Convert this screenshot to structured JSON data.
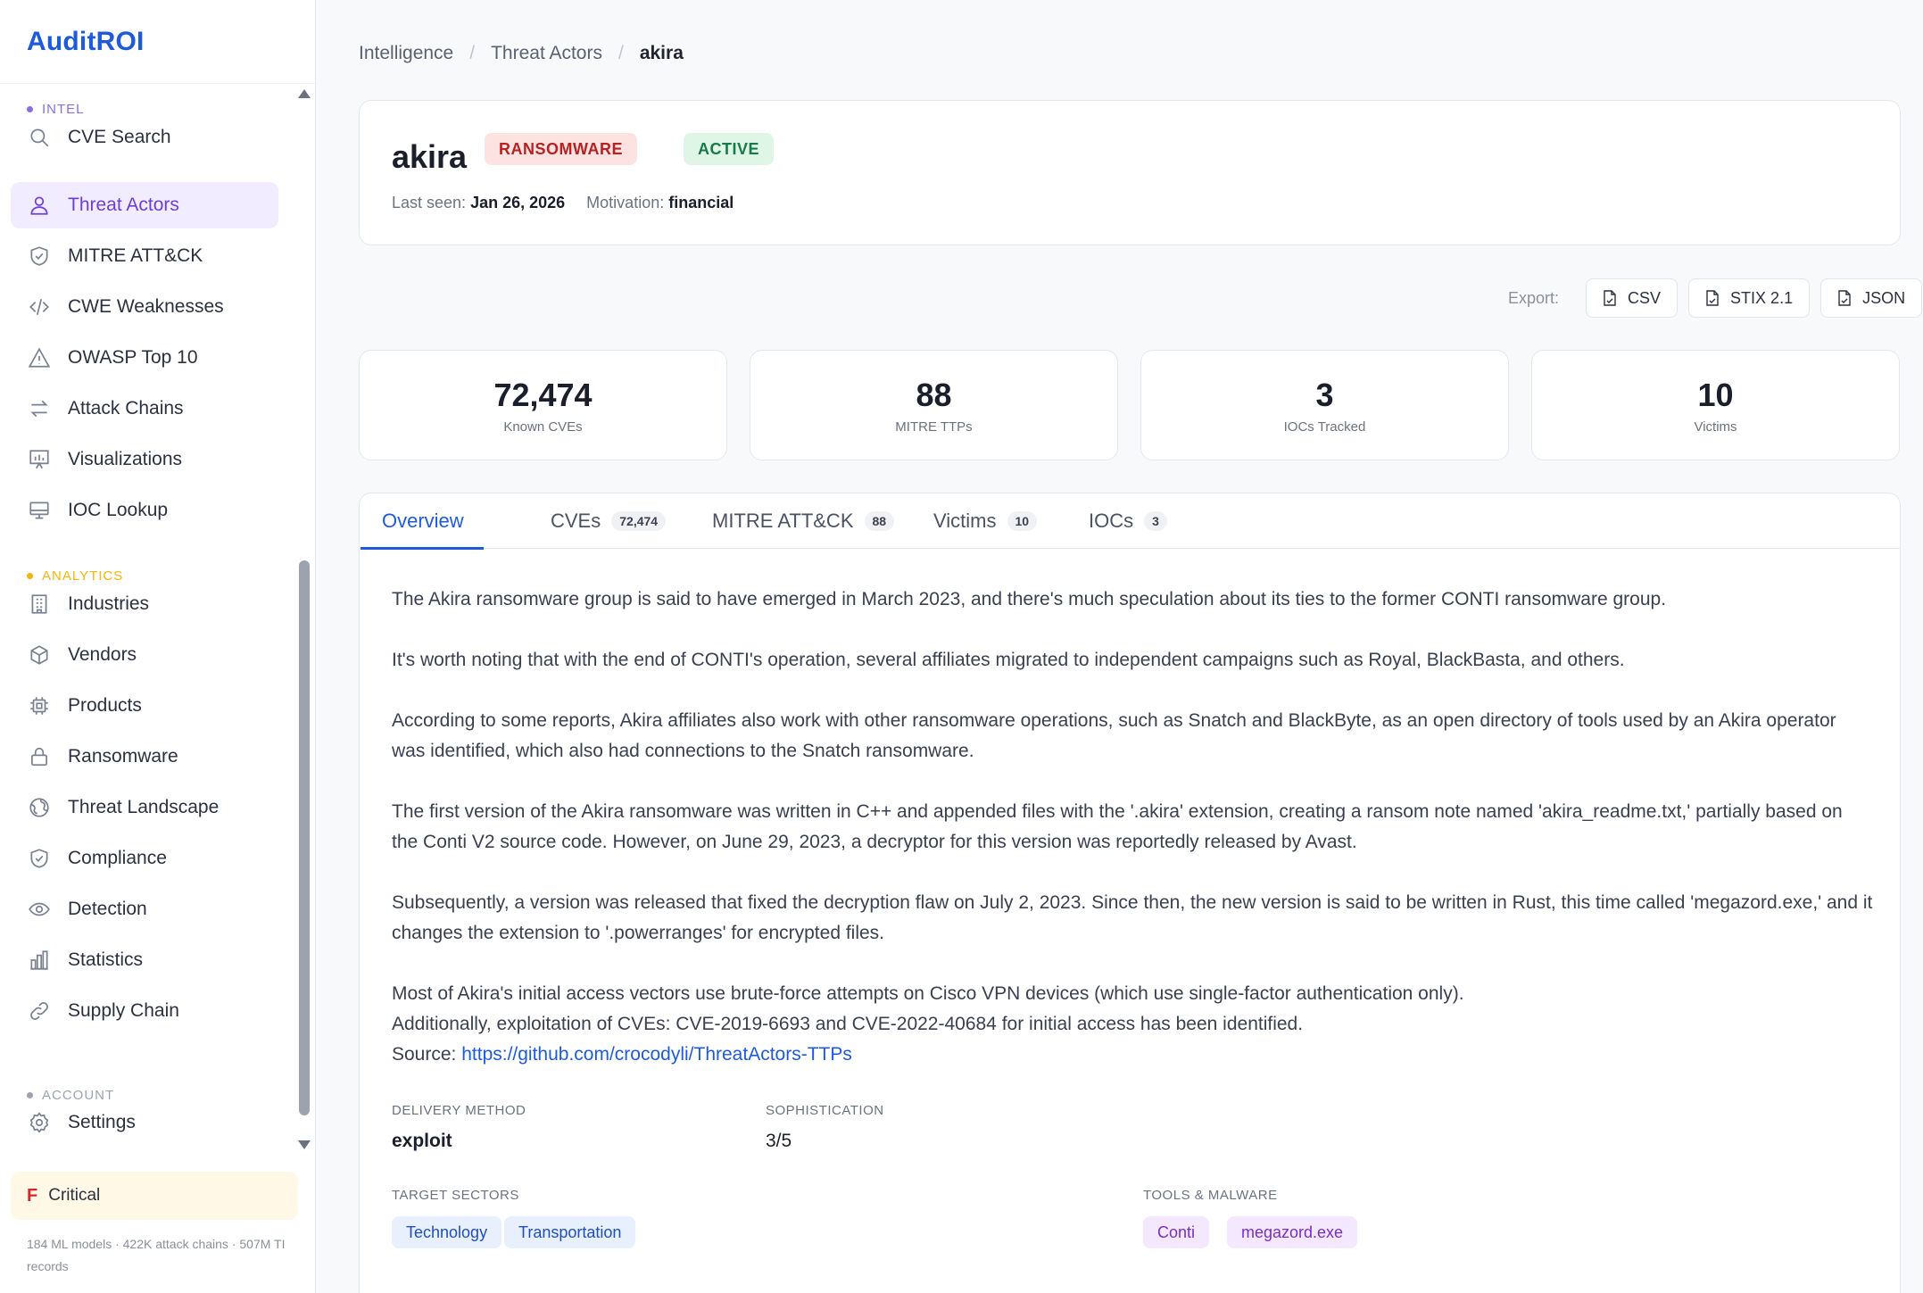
{
  "brand": "AuditROI",
  "sidebar": {
    "sections": {
      "intel": "INTEL",
      "analytics": "ANALYTICS",
      "account": "ACCOUNT"
    },
    "colors": {
      "intel": "#8b6fe0",
      "analytics": "#f5b50a",
      "account": "#9ca3af"
    },
    "items": [
      {
        "label": "CVE Search",
        "icon": "search-icon"
      },
      {
        "label": "Threat Actors",
        "icon": "user-icon"
      },
      {
        "label": "MITRE ATT&CK",
        "icon": "shield-icon"
      },
      {
        "label": "CWE Weaknesses",
        "icon": "code-icon"
      },
      {
        "label": "OWASP Top 10",
        "icon": "warning-icon"
      },
      {
        "label": "Attack Chains",
        "icon": "arrows-icon"
      },
      {
        "label": "Visualizations",
        "icon": "presentation-icon"
      },
      {
        "label": "IOC Lookup",
        "icon": "monitor-icon"
      },
      {
        "label": "Industries",
        "icon": "building-icon"
      },
      {
        "label": "Vendors",
        "icon": "box-icon"
      },
      {
        "label": "Products",
        "icon": "chip-icon"
      },
      {
        "label": "Ransomware",
        "icon": "lock-icon"
      },
      {
        "label": "Threat Landscape",
        "icon": "globe-icon"
      },
      {
        "label": "Compliance",
        "icon": "shield-check-icon"
      },
      {
        "label": "Detection",
        "icon": "eye-icon"
      },
      {
        "label": "Statistics",
        "icon": "bar-chart-icon"
      },
      {
        "label": "Supply Chain",
        "icon": "link-icon"
      },
      {
        "label": "Settings",
        "icon": "gear-icon"
      }
    ],
    "active_item": "Threat Actors",
    "risk": {
      "grade": "F",
      "label": "Critical"
    },
    "footnote": "184 ML models · 422K attack chains · 507M TI records"
  },
  "breadcrumb": [
    "Intelligence",
    "Threat Actors",
    "akira"
  ],
  "actor": {
    "name": "akira",
    "type_badge": "RANSOMWARE",
    "status_badge": "ACTIVE",
    "last_seen_label": "Last seen:",
    "last_seen": "Jan 26, 2026",
    "motivation_label": "Motivation:",
    "motivation": "financial"
  },
  "export": {
    "label": "Export:",
    "buttons": [
      "CSV",
      "STIX 2.1",
      "JSON"
    ]
  },
  "stats": [
    {
      "value": "72,474",
      "label": "Known CVEs"
    },
    {
      "value": "88",
      "label": "MITRE TTPs"
    },
    {
      "value": "3",
      "label": "IOCs Tracked"
    },
    {
      "value": "10",
      "label": "Victims"
    }
  ],
  "tabs": [
    {
      "label": "Overview",
      "count": ""
    },
    {
      "label": "CVEs",
      "count": "72,474"
    },
    {
      "label": "MITRE ATT&CK",
      "count": "88"
    },
    {
      "label": "Victims",
      "count": "10"
    },
    {
      "label": "IOCs",
      "count": "3"
    }
  ],
  "overview": {
    "paragraphs": [
      "The Akira ransomware group is said to have emerged in March 2023, and there's much speculation about its ties to the former CONTI ransomware group.",
      "It's worth noting that with the end of CONTI's operation, several affiliates migrated to independent campaigns such as Royal, BlackBasta, and others.",
      "According to some reports, Akira affiliates also work with other ransomware operations, such as Snatch and BlackByte, as an open directory of tools used by an Akira operator was identified, which also had connections to the Snatch ransomware.",
      "The first version of the Akira ransomware was written in C++ and appended files with the '.akira' extension, creating a ransom note named 'akira_readme.txt,' partially based on the Conti V2 source code. However, on June 29, 2023, a decryptor for this version was reportedly released by Avast.",
      "Subsequently, a version was released that fixed the decryption flaw on July 2, 2023. Since then, the new version is said to be written in Rust, this time called 'megazord.exe,' and it changes the extension to '.powerranges' for encrypted files."
    ],
    "line_access": "Most of Akira's initial access vectors use brute-force attempts on Cisco VPN devices (which use single-factor authentication only).",
    "line_cves": "Additionally, exploitation of CVEs: CVE-2019-6693 and CVE-2022-40684 for initial access has been identified.",
    "source_label": "Source:",
    "source_link": "https://github.com/crocodyli/ThreatActors-TTPs"
  },
  "details": {
    "delivery_label": "DELIVERY METHOD",
    "delivery": "exploit",
    "sophistication_label": "SOPHISTICATION",
    "sophistication": "3/5",
    "sectors_label": "TARGET SECTORS",
    "sectors": [
      "Technology",
      "Transportation"
    ],
    "tools_label": "TOOLS & MALWARE",
    "tools": [
      "Conti",
      "megazord.exe"
    ]
  }
}
